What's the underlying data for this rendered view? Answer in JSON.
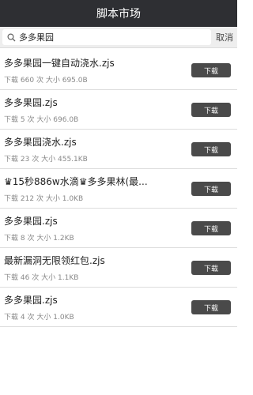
{
  "header": {
    "title": "脚本市场"
  },
  "search": {
    "value": "多多果园",
    "cancel_label": "取消",
    "icon": "search-icon"
  },
  "scripts": [
    {
      "title": "多多果园一键自动浇水.zjs",
      "downloads": "660",
      "size": "695.0B"
    },
    {
      "title": "多多果园.zjs",
      "downloads": "5",
      "size": "696.0B"
    },
    {
      "title": "多多果园浇水.zjs",
      "downloads": "23",
      "size": "455.1KB"
    },
    {
      "title": "♛15秒886w水滴♛多多果林(最...",
      "downloads": "212",
      "size": "1.0KB"
    },
    {
      "title": "多多果园.zjs",
      "downloads": "8",
      "size": "1.2KB"
    },
    {
      "title": "最新漏洞无限领红包.zjs",
      "downloads": "46",
      "size": "1.1KB"
    },
    {
      "title": "多多果园.zjs",
      "downloads": "4",
      "size": "1.0KB"
    }
  ],
  "labels": {
    "download_prefix": "下载",
    "download_suffix": "次",
    "size_label": "大小",
    "download_button": "下载"
  },
  "colors": {
    "header_bg": "#2e2f33",
    "button_bg": "#4a4a4a",
    "meta_text": "#888888"
  }
}
